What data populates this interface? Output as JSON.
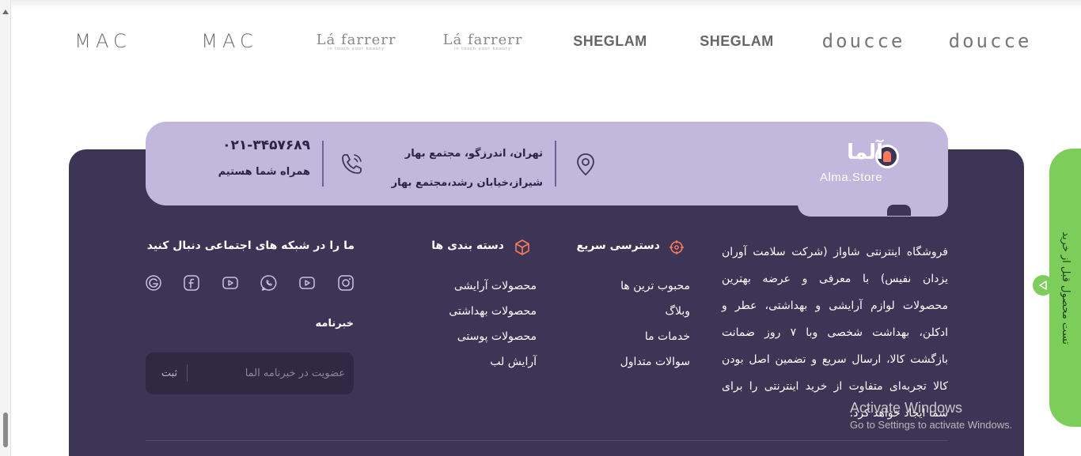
{
  "brands": [
    {
      "label": "MAC"
    },
    {
      "label": "MAC"
    },
    {
      "label": "Lá farrerr",
      "tagline": "in touch your beauty"
    },
    {
      "label": "Lá farrerr",
      "tagline": "in touch your beauty"
    },
    {
      "label": "SHEGLAM"
    },
    {
      "label": "SHEGLAM"
    },
    {
      "label": "doucce"
    },
    {
      "label": "doucce"
    }
  ],
  "logo": {
    "name": "آلما",
    "sub": "Alma.Store"
  },
  "contact": {
    "address_1": "تهران، اندرزگو، مجتمع بهار",
    "address_2": "شیراز،خیابان رشد،مجتمع بهار",
    "phone": "۰۲۱-۳۴۵۷۶۸۹",
    "phone_label": "همراه شما هستیم"
  },
  "about": "فروشگاه اینترنتی شاواز (شرکت سلامت آوران یزدان نفیس) با معرفی و عرضه بهترین محصولات لوازم آرایشی و بهداشتی، عطر و ادکلن، بهداشت شخصی وبا ۷ روز ضمانت بازگشت کالا، ارسال سریع و تضمین اصل بودن کالا تجربه‌ای متفاوت از خرید اینترنتی را برای شما ایجاد خواهد کرد.",
  "quick_access": {
    "title": "دسترسی سریع",
    "links": [
      "محبوب ترین ها",
      "وبلاگ",
      "خدمات ما",
      "سوالات متداول"
    ]
  },
  "categories": {
    "title": "دسته بندی ها",
    "links": [
      "محصولات آرایشی",
      "محصولات بهداشتی",
      "محصولات پوستی",
      "آرایش لب"
    ]
  },
  "social": {
    "title": "ما را در شبکه های اجتماعی دنبال کنید",
    "icons": [
      "instagram-icon",
      "youtube-icon",
      "whatsapp-icon",
      "youtube-icon",
      "facebook-icon",
      "google-icon"
    ]
  },
  "newsletter": {
    "title": "خبرنامه",
    "placeholder": "عضویت در خبرنامه آلما",
    "button": "ثبت"
  },
  "side_tab": {
    "label": "تست محصول قبل از خرید"
  },
  "windows": {
    "title": "Activate Windows",
    "subtitle": "Go to Settings to activate Windows."
  },
  "colors": {
    "footer_bg": "#3d3556",
    "contact_bg": "#c2b8de",
    "accent": "#ff7a5c",
    "side_tab": "#7ccd5a"
  }
}
